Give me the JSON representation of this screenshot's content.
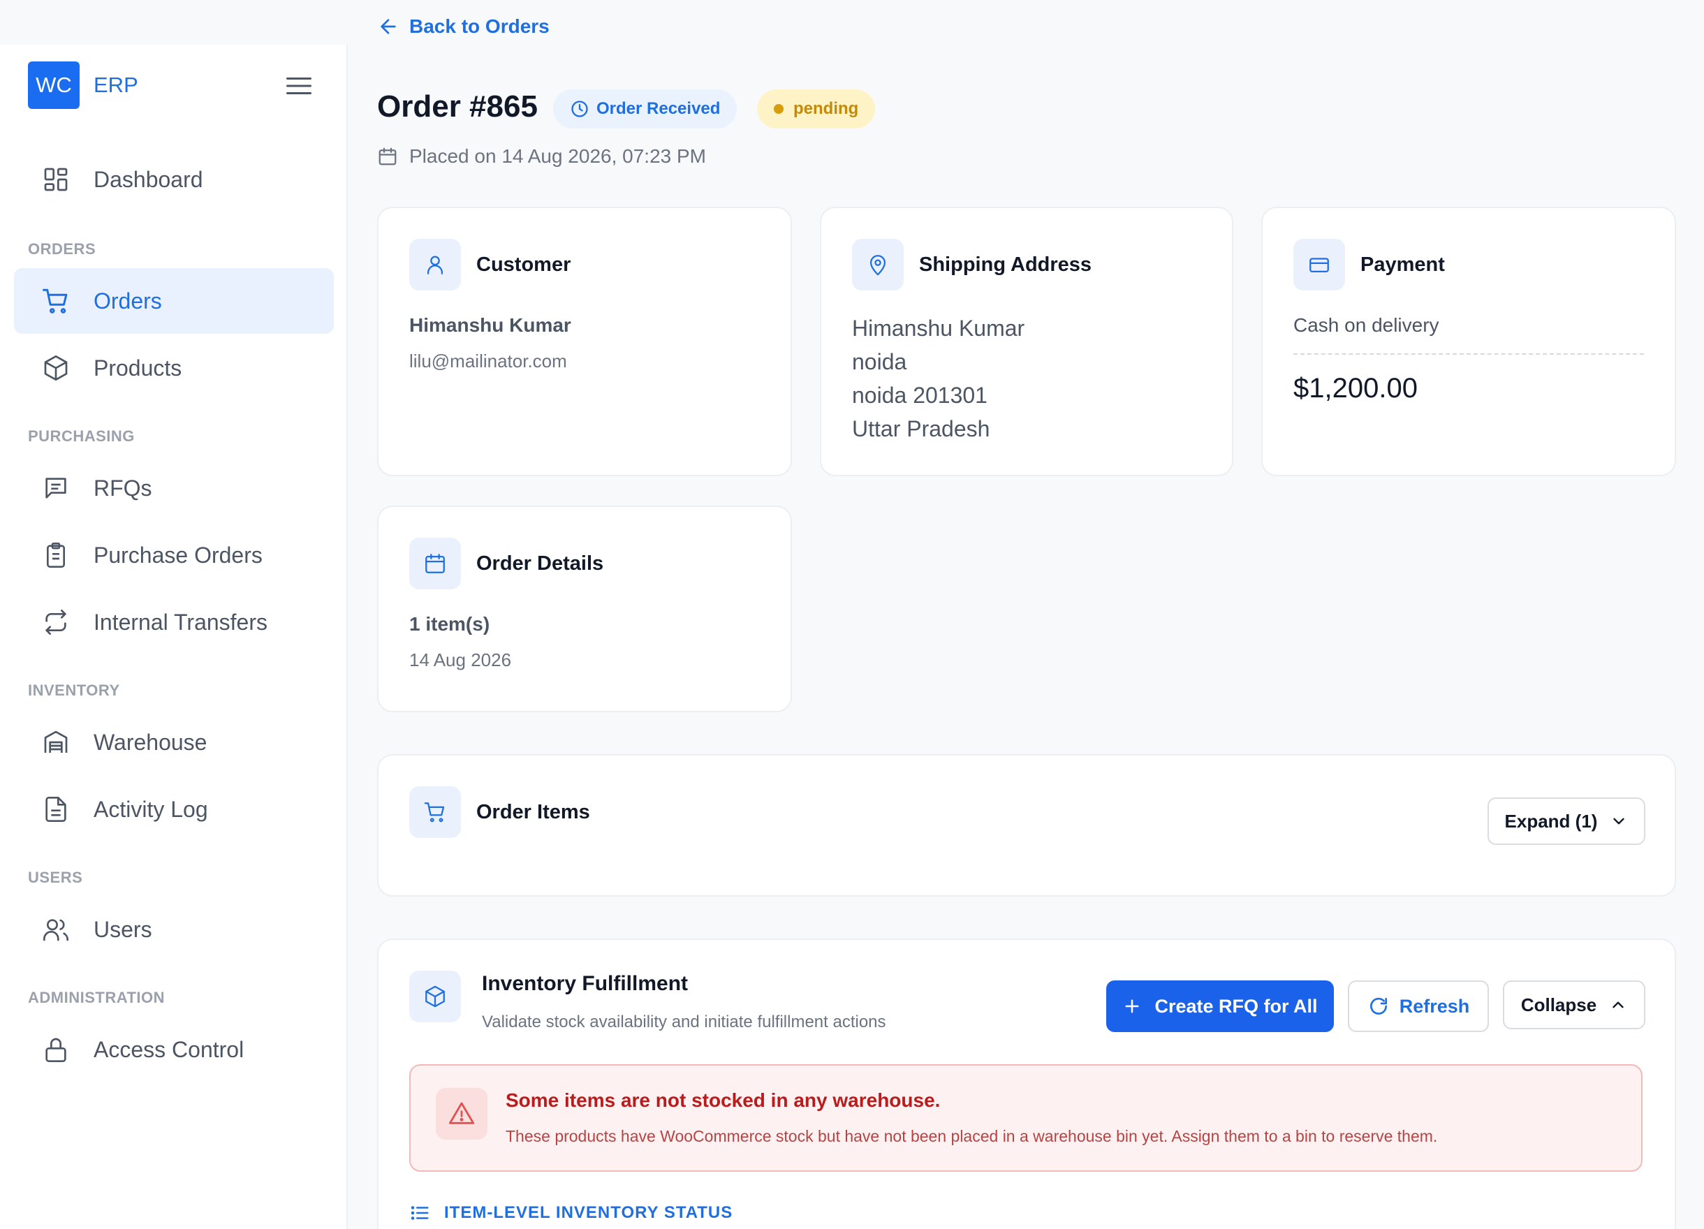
{
  "sidebar": {
    "brand_logo": "WC",
    "brand_name": "ERP",
    "dashboard": "Dashboard",
    "sections": {
      "orders": "ORDERS",
      "purchasing": "PURCHASING",
      "inventory": "INVENTORY",
      "users": "USERS",
      "administration": "ADMINISTRATION"
    },
    "items": {
      "orders": "Orders",
      "products": "Products",
      "rfqs": "RFQs",
      "purchase_orders": "Purchase Orders",
      "internal_transfers": "Internal Transfers",
      "warehouse": "Warehouse",
      "activity_log": "Activity Log",
      "users": "Users",
      "access_control": "Access Control"
    },
    "active_item": "Orders"
  },
  "header": {
    "back_label": "Back to Orders",
    "order_title": "Order #865",
    "status_badge": "Order Received",
    "payment_badge": "pending",
    "placed_on": "Placed on 14 Aug 2026, 07:23 PM"
  },
  "customer": {
    "title": "Customer",
    "name": "Himanshu Kumar",
    "email": "lilu@mailinator.com"
  },
  "shipping": {
    "title": "Shipping Address",
    "line1": "Himanshu Kumar",
    "line2": "noida",
    "line3": "noida 201301",
    "line4": "Uttar Pradesh"
  },
  "payment": {
    "title": "Payment",
    "method": "Cash on delivery",
    "amount": "$1,200.00"
  },
  "order_details": {
    "title": "Order Details",
    "items": "1 item(s)",
    "date": "14 Aug 2026"
  },
  "order_items": {
    "title": "Order Items",
    "expand_label": "Expand (1)"
  },
  "fulfillment": {
    "title": "Inventory Fulfillment",
    "subtitle": "Validate stock availability and initiate fulfillment actions",
    "create_rfq_label": "Create RFQ for All",
    "refresh_label": "Refresh",
    "collapse_label": "Collapse",
    "alert_title": "Some items are not stocked in any warehouse.",
    "alert_text": "These products have WooCommerce stock but have not been placed in a warehouse bin yet. Assign them to a bin to reserve them.",
    "item_level_label": "ITEM-LEVEL INVENTORY STATUS"
  },
  "colors": {
    "accent": "#1f6fe0",
    "primary_button": "#1a62ea",
    "pending": "#c28a0c",
    "error": "#b91c1c"
  }
}
